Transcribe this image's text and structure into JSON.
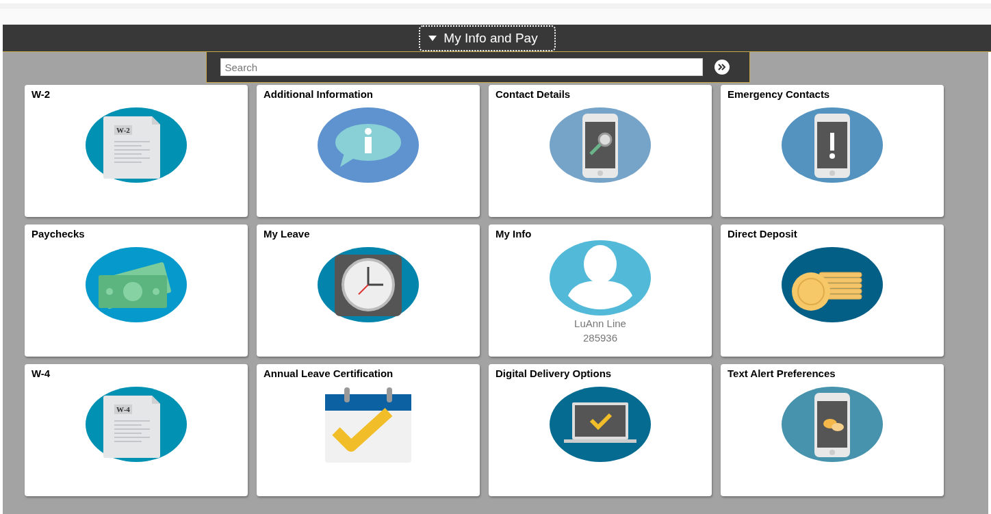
{
  "header": {
    "title": "My Info and Pay",
    "expanded": false
  },
  "search": {
    "placeholder": "Search"
  },
  "tiles": [
    {
      "title": "W-2",
      "kind": "document",
      "icon_label": "W-2"
    },
    {
      "title": "Additional Information",
      "kind": "info"
    },
    {
      "title": "Contact Details",
      "kind": "phone-search"
    },
    {
      "title": "Emergency Contacts",
      "kind": "phone-alert"
    },
    {
      "title": "Paychecks",
      "kind": "money"
    },
    {
      "title": "My Leave",
      "kind": "clock"
    },
    {
      "title": "My Info",
      "kind": "person",
      "lines": [
        "LuAnn Line",
        "285936"
      ]
    },
    {
      "title": "Direct Deposit",
      "kind": "coins"
    },
    {
      "title": "W-4",
      "kind": "document",
      "icon_label": "W-4"
    },
    {
      "title": "Annual Leave Certification",
      "kind": "calendar"
    },
    {
      "title": "Digital Delivery Options",
      "kind": "laptop"
    },
    {
      "title": "Text Alert Preferences",
      "kind": "phone-chat"
    }
  ]
}
